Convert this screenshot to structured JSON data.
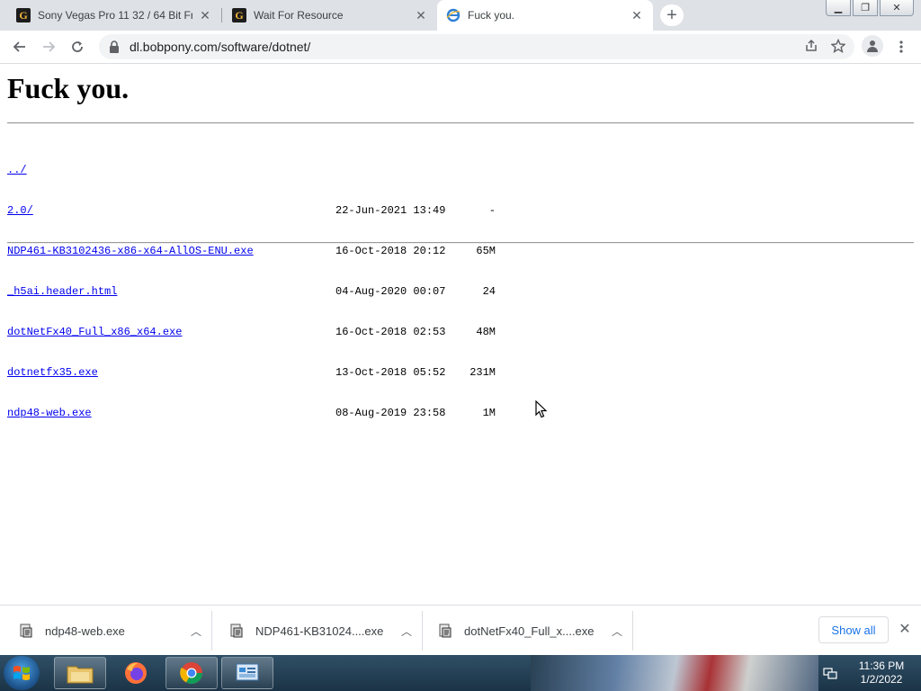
{
  "browser": {
    "tabs": [
      {
        "title": "Sony Vegas Pro 11 32 / 64 Bit Fr",
        "favicon": "g-logo-icon",
        "active": false
      },
      {
        "title": "Wait For Resource",
        "favicon": "g-logo-icon",
        "active": false
      },
      {
        "title": "Fuck you.",
        "favicon": "ie-page-icon",
        "active": true
      }
    ],
    "url": "dl.bobpony.com/software/dotnet/"
  },
  "page": {
    "heading": "Fuck you.",
    "parent_link": "../",
    "entries": [
      {
        "name": "2.0/",
        "date": "22-Jun-2021 13:49",
        "size": "-"
      },
      {
        "name": "NDP461-KB3102436-x86-x64-AllOS-ENU.exe",
        "date": "16-Oct-2018 20:12",
        "size": "65M"
      },
      {
        "name": "_h5ai.header.html",
        "date": "04-Aug-2020 00:07",
        "size": "24"
      },
      {
        "name": "dotNetFx40_Full_x86_x64.exe",
        "date": "16-Oct-2018 02:53",
        "size": "48M"
      },
      {
        "name": "dotnetfx35.exe",
        "date": "13-Oct-2018 05:52",
        "size": "231M"
      },
      {
        "name": "ndp48-web.exe",
        "date": "08-Aug-2019 23:58",
        "size": "1M"
      }
    ]
  },
  "downloads": {
    "items": [
      {
        "name": "ndp48-web.exe"
      },
      {
        "name": "NDP461-KB31024....exe"
      },
      {
        "name": "dotNetFx40_Full_x....exe"
      }
    ],
    "show_all": "Show all"
  },
  "taskbar": {
    "time": "11:36 PM",
    "date": "1/2/2022"
  },
  "colors": {
    "link": "#0000ee",
    "accent": "#1a73e8",
    "tabstrip": "#dee1e6"
  }
}
